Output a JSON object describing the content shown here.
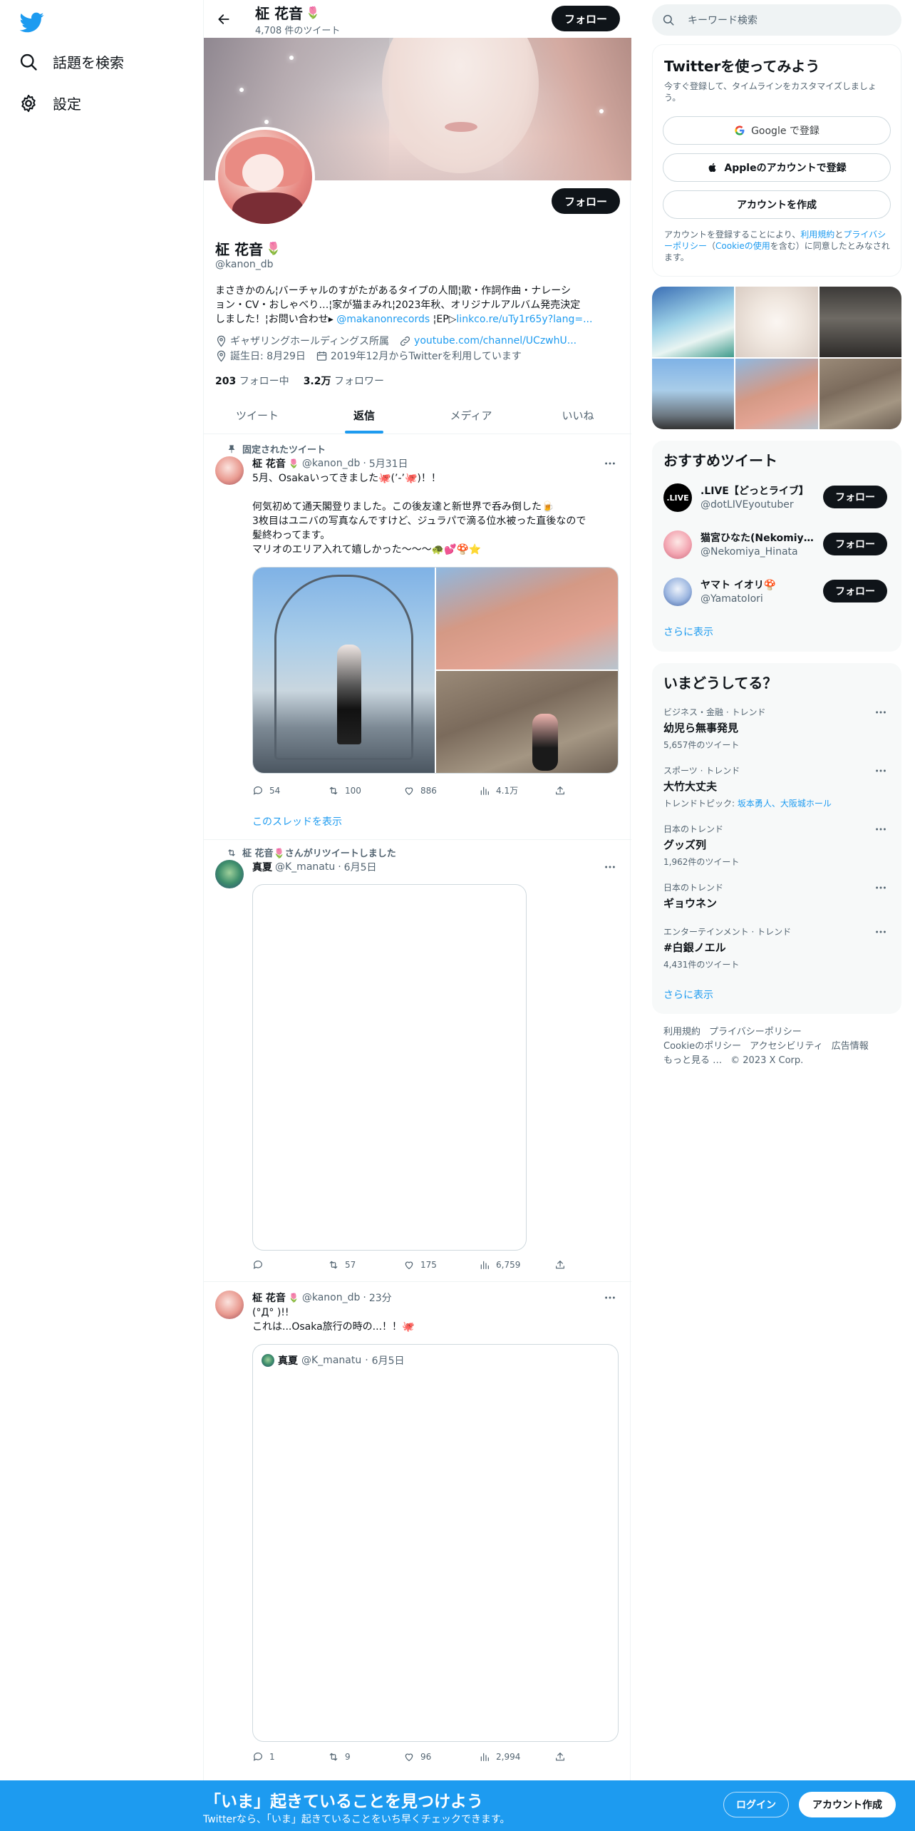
{
  "nav": {
    "explore_label": "話題を検索",
    "settings_label": "設定"
  },
  "header": {
    "name": "柾 花音",
    "tweet_count": "4,708 件のツイート",
    "follow_label": "フォロー"
  },
  "profile": {
    "name": "柾 花音",
    "handle": "@kanon_db",
    "follow_label": "フォロー",
    "bio_line1": "まさきかのん¦バーチャルのすがたがあるタイプの人間¦歌・作詞作曲・ナレーシ",
    "bio_line2": "ョン・CV・おしゃべり…¦家が猫まみれ¦2023年秋、オリジナルアルバム発売決定",
    "bio_line3_a": "しました！¦お問い合わせ▸ ",
    "bio_mention": "@makanonrecords",
    "bio_line3_b": " ¦EP▷",
    "bio_link": "linkco.re/uTy1r65y?lang=...",
    "affiliation": "ギャザリングホールディングス所属",
    "website": "youtube.com/channel/UCzwhU...",
    "birthday": "誕生日: 8月29日",
    "joined": "2019年12月からTwitterを利用しています",
    "following_count": "203",
    "following_label": "フォロー中",
    "followers_count": "3.2万",
    "followers_label": "フォロワー"
  },
  "tabs": [
    "ツイート",
    "返信",
    "メディア",
    "いいね"
  ],
  "active_tab": "返信",
  "tweets": [
    {
      "context": "固定されたツイート",
      "name": "柾 花音",
      "handle": "@kanon_db",
      "date": "5月31日",
      "text": "5月、Osakaいってきました🐙(’-’🐙)！！\n\n何気初めて通天閣登りました。この後友達と新世界で呑み倒した🍺\n3枚目はユニバの写真なんですけど、ジュラパで滴る位水被った直後なので\n髪終わってます。\nマリオのエリア入れて嬉しかった〜〜〜🐢💕🍄⭐",
      "reply": "54",
      "retweet": "100",
      "like": "886",
      "views": "4.1万",
      "thread_link": "このスレッドを表示"
    },
    {
      "context": "柾 花音🌷さんがリツイートしました",
      "name": "真夏",
      "handle": "@K_manatu",
      "date": "6月5日",
      "reply": "",
      "retweet": "57",
      "like": "175",
      "views": "6,759"
    },
    {
      "name": "柾 花音",
      "handle": "@kanon_db",
      "date": "23分",
      "text": "(°Д° )!!\nこれは...Osaka旅行の時の...！！🐙",
      "quote_name": "真夏",
      "quote_handle": "@K_manatu",
      "quote_date": "6月5日",
      "reply": "1",
      "retweet": "9",
      "like": "96",
      "views": "2,994"
    }
  ],
  "right": {
    "search_placeholder": "キーワード検索",
    "signup_card": {
      "title": "Twitterを使ってみよう",
      "subtitle": "今すぐ登録して、タイムラインをカスタマイズしましょう。",
      "google": "Google で登録",
      "apple": "Appleのアカウントで登録",
      "create": "アカウントを作成",
      "legal_a": "アカウントを登録することにより、",
      "legal_terms": "利用規約",
      "legal_b": "と",
      "legal_privacy": "プライバシーポリシー",
      "legal_c": "（",
      "legal_cookie": "Cookieの使用",
      "legal_d": "を含む）に同意したとみなされます。"
    },
    "reco": {
      "title": "おすすめツイート",
      "accounts": [
        {
          "name": ".LIVE【どっとライブ】",
          "handle": "@dotLIVEyoutuber",
          "avatar_text": ".LIVE"
        },
        {
          "name": "猫宮ひなた(Nekomiya...",
          "handle": "@Nekomiya_Hinata"
        },
        {
          "name": "ヤマト イオリ🍄",
          "handle": "@YamatoIori"
        }
      ],
      "follow_label": "フォロー",
      "show_more": "さらに表示"
    },
    "trends": {
      "title": "いまどうしてる？",
      "items": [
        {
          "category": "ビジネス・金融 · トレンド",
          "name": "幼児ら無事発見",
          "sub": "5,657件のツイート"
        },
        {
          "category": "スポーツ · トレンド",
          "name": "大竹大丈夫",
          "sub_prefix": "トレンドトピック: ",
          "sub_link": "坂本勇人、大阪城ホール"
        },
        {
          "category": "日本のトレンド",
          "name": "グッズ列",
          "sub": "1,962件のツイート"
        },
        {
          "category": "日本のトレンド",
          "name": "ギョウネン"
        },
        {
          "category": "エンターテインメント · トレンド",
          "name": "#白銀ノエル",
          "sub": "4,431件のツイート"
        }
      ],
      "show_more": "さらに表示"
    },
    "footer": {
      "terms": "利用規約",
      "privacy": "プライバシーポリシー",
      "cookie": "Cookieのポリシー",
      "accessibility": "アクセシビリティ",
      "ads": "広告情報",
      "more": "もっと見る …",
      "copyright": "© 2023 X Corp."
    }
  },
  "bottom_bar": {
    "title": "「いま」起きていることを見つけよう",
    "subtitle": "Twitterなら、「いま」起きていることをいち早くチェックできます。",
    "login": "ログイン",
    "signup": "アカウント作成"
  },
  "colors": {
    "accent": "#1d9bf0",
    "text": "#0f1419",
    "muted": "#536471",
    "border": "#eff3f4"
  }
}
